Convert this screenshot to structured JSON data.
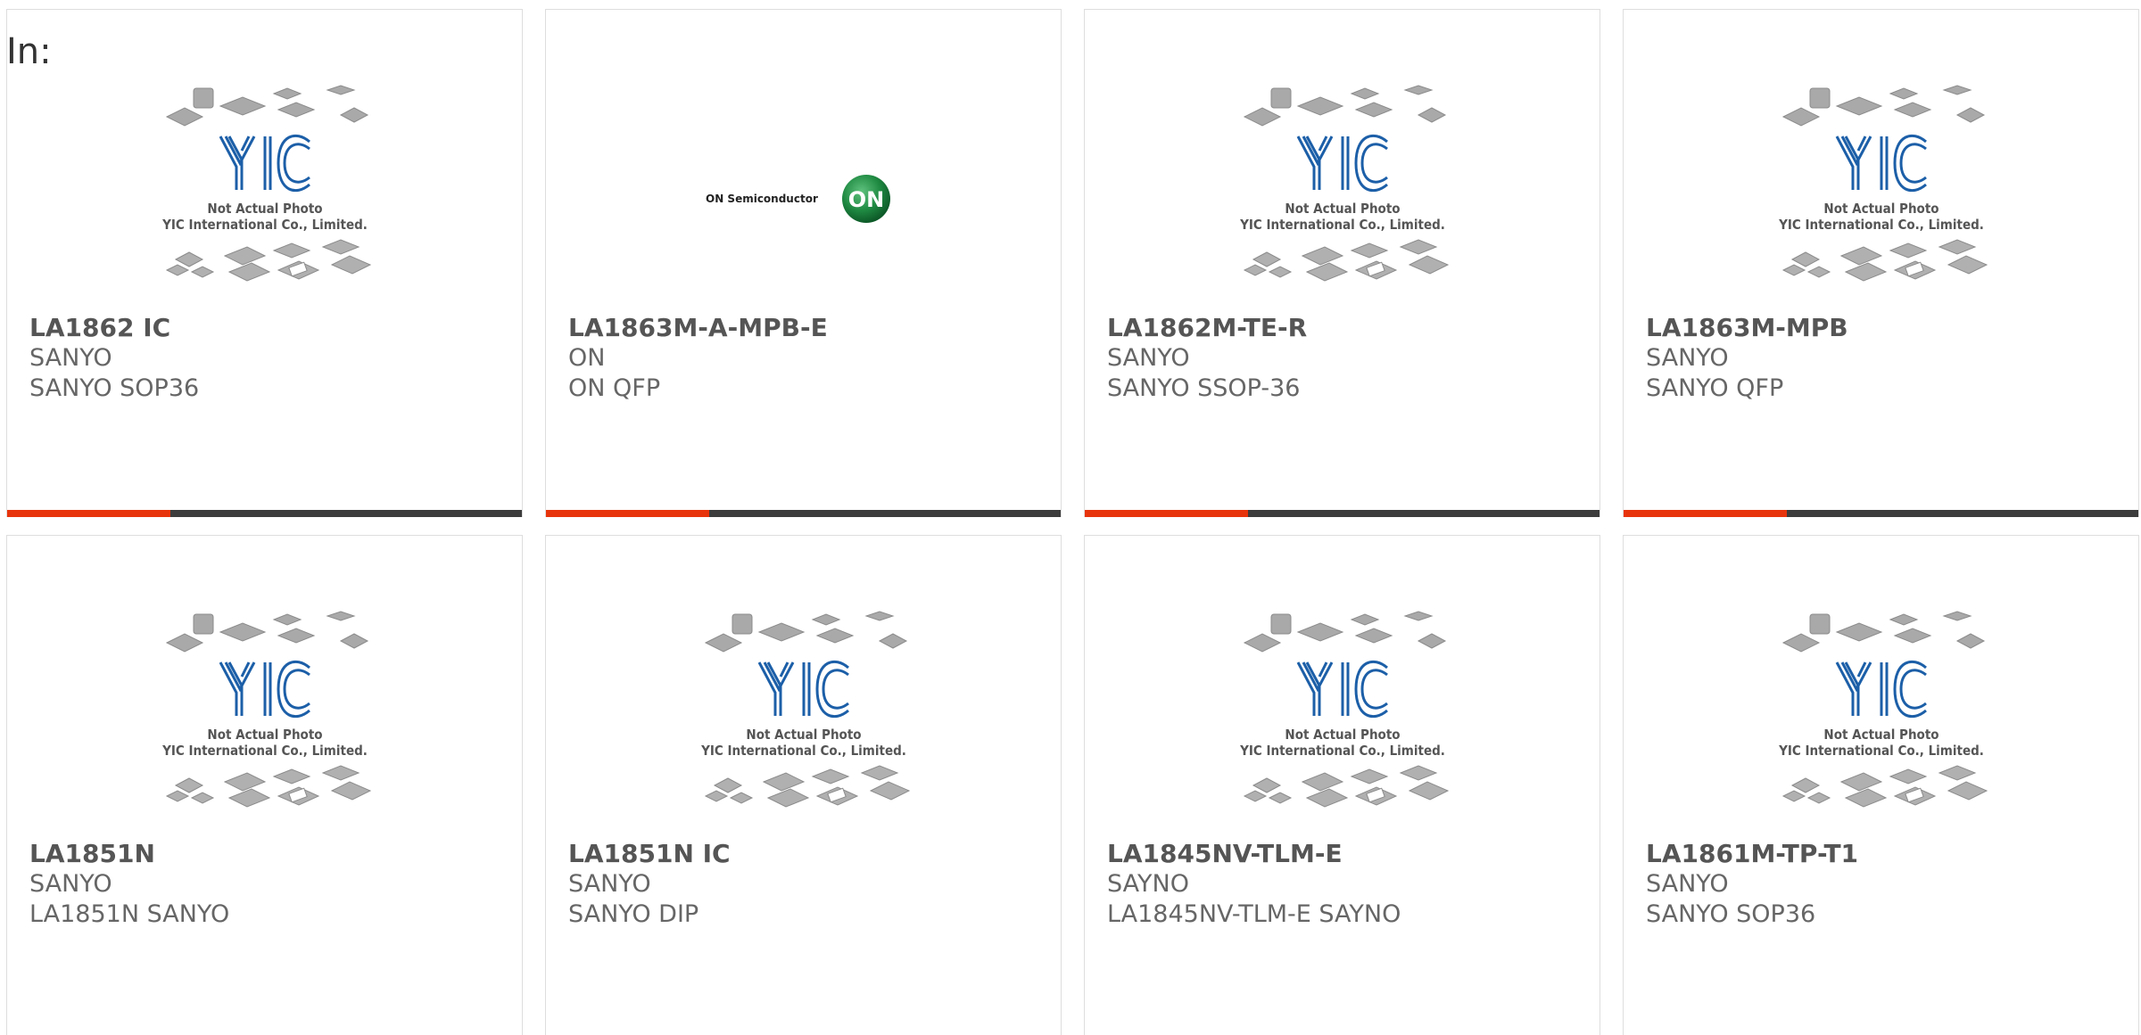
{
  "header": {
    "label": "In:"
  },
  "colors": {
    "accent": "#e8340c",
    "bar": "#3c3c3c"
  },
  "placeholder_image": {
    "line1": "Not Actual Photo",
    "line2": "YIC International Co., Limited.",
    "logo_text": "YIC"
  },
  "on_logo": {
    "text": "ON Semiconductor",
    "badge": "ON"
  },
  "products": [
    {
      "part": "LA1862 IC",
      "manufacturer": "SANYO",
      "description": "SANYO SOP36",
      "image": "placeholder"
    },
    {
      "part": "LA1863M-A-MPB-E",
      "manufacturer": "ON",
      "description": "ON QFP",
      "image": "on-logo"
    },
    {
      "part": "LA1862M-TE-R",
      "manufacturer": "SANYO",
      "description": "SANYO SSOP-36",
      "image": "placeholder"
    },
    {
      "part": "LA1863M-MPB",
      "manufacturer": "SANYO",
      "description": "SANYO QFP",
      "image": "placeholder"
    },
    {
      "part": "LA1851N",
      "manufacturer": "SANYO",
      "description": "LA1851N SANYO",
      "image": "placeholder"
    },
    {
      "part": "LA1851N IC",
      "manufacturer": "SANYO",
      "description": "SANYO DIP",
      "image": "placeholder"
    },
    {
      "part": "LA1845NV-TLM-E",
      "manufacturer": "SAYNO",
      "description": "LA1845NV-TLM-E SAYNO",
      "image": "placeholder"
    },
    {
      "part": "LA1861M-TP-T1",
      "manufacturer": "SANYO",
      "description": "SANYO SOP36",
      "image": "placeholder"
    }
  ]
}
